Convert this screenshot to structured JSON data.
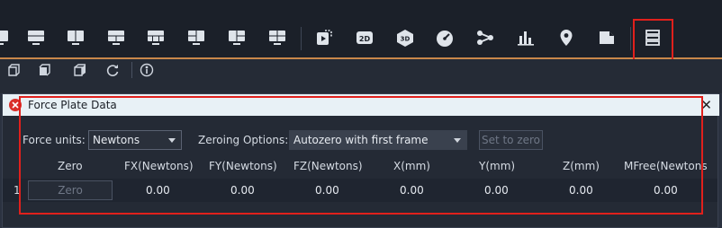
{
  "toolbar": {
    "icons": [
      "view-single-icon",
      "view-split-horizontal-icon",
      "view-split-vertical-icon",
      "view-quad-top-icon",
      "view-grid-icon",
      "view-quad-icon",
      "view-quad-alt-icon",
      "video-record-icon",
      "view-2d-icon",
      "view-3d-icon",
      "gauge-icon",
      "graph-nodes-icon",
      "bar-chart-icon",
      "map-pin-icon",
      "document-icon",
      "data-panel-icon"
    ],
    "icon_labels": {
      "view_2d": "2D",
      "view_3d": "3D"
    }
  },
  "subtoolbar": {
    "icons": [
      "cube-front-icon",
      "cube-side-icon",
      "cube-iso-icon",
      "refresh-icon",
      "target-person-icon"
    ]
  },
  "panel": {
    "title": "Force Plate Data",
    "force_units_label": "Force units:",
    "force_units_value": "Newtons",
    "zeroing_label": "Zeroing Options:",
    "zeroing_value": "Autozero with first frame",
    "set_to_zero_label": "Set to zero",
    "columns": [
      "Zero",
      "FX(Newtons)",
      "FY(Newtons)",
      "FZ(Newtons)",
      "X(mm)",
      "Y(mm)",
      "Z(mm)",
      "MFree(Newtons"
    ],
    "rows": [
      {
        "index": "1",
        "zero_button": "Zero",
        "values": [
          "0.00",
          "0.00",
          "0.00",
          "0.00",
          "0.00",
          "0.00",
          "0.00"
        ]
      }
    ]
  },
  "colors": {
    "accent_line": "#c8874a",
    "highlight": "#e0201c",
    "title_bg": "#e8f1f6"
  }
}
